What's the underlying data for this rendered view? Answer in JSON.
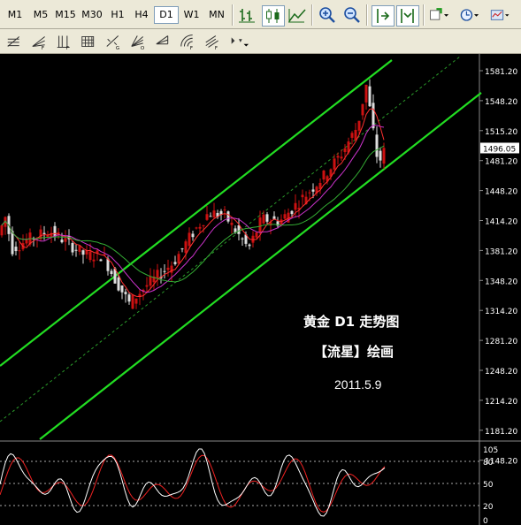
{
  "toolbar": {
    "timeframes": [
      "M1",
      "M5",
      "M15",
      "M30",
      "H1",
      "H4",
      "D1",
      "W1",
      "MN"
    ],
    "active_timeframe": "D1"
  },
  "drawing_toolbar": {
    "tools": [
      {
        "name": "fibo-retracement-tool",
        "sub": ""
      },
      {
        "name": "fibo-fan-tool",
        "sub": "F"
      },
      {
        "name": "fibo-time-zones-tool",
        "sub": "F"
      },
      {
        "name": "gann-grid-tool",
        "sub": ""
      },
      {
        "name": "gann-line-tool",
        "sub": "G"
      },
      {
        "name": "gann-fan-tool",
        "sub": "O"
      },
      {
        "name": "andrews-pitchfork-tool",
        "sub": ""
      },
      {
        "name": "fibo-arc-tool",
        "sub": "F"
      },
      {
        "name": "fibo-channel-tool",
        "sub": "F"
      },
      {
        "name": "arrows-tool",
        "sub": ""
      }
    ]
  },
  "chart": {
    "price_axis": [
      "1581.20",
      "1548.20",
      "1515.20",
      "1481.20",
      "1448.20",
      "1414.20",
      "1381.20",
      "1348.20",
      "1314.20",
      "1281.20",
      "1248.20",
      "1214.20",
      "1181.20",
      "1148.20"
    ],
    "current_price": "1496.05",
    "annotation_title": "黄金 D1 走势图",
    "annotation_author": "【流星】绘画",
    "annotation_date": "2011.5.9"
  },
  "oscillator": {
    "levels": [
      "105",
      "80",
      "50",
      "20",
      "0"
    ]
  },
  "colors": {
    "background": "#000000",
    "channel": "#22dd22",
    "bull_candle": "#cc1111",
    "bear_candle": "#dddddd",
    "ma_fast": "#ff3030",
    "ma_mid": "#cc33cc",
    "ma_slow": "#33aa33",
    "stoch_main": "#ffffff",
    "stoch_signal": "#ee2222",
    "axis_text": "#ffffff"
  }
}
